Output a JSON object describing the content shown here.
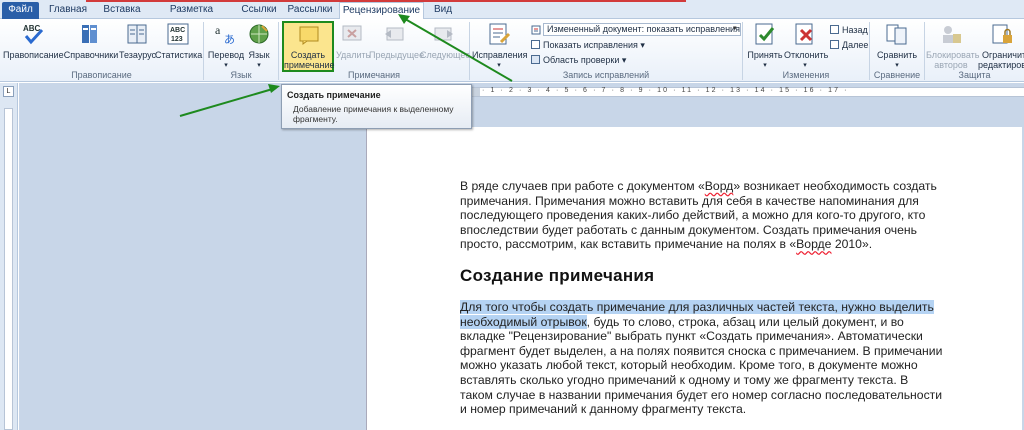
{
  "tabs": [
    {
      "label": "Файл",
      "kind": "file"
    },
    {
      "label": "Главная"
    },
    {
      "label": "Вставка"
    },
    {
      "label": "Разметка страницы"
    },
    {
      "label": "Ссылки"
    },
    {
      "label": "Рассылки"
    },
    {
      "label": "Рецензирование",
      "active": true
    },
    {
      "label": "Вид"
    }
  ],
  "ribbon": {
    "spelling": "Правописание",
    "references": "Справочники",
    "thesaurus": "Тезаурус",
    "statistics": "Статистика",
    "translate": "Перевод",
    "language": "Язык",
    "new_comment_l1": "Создать",
    "new_comment_l2": "примечание",
    "delete": "Удалить",
    "previous": "Предыдущее",
    "next": "Следующее",
    "track_changes": "Исправления",
    "display_for_review": "Измененный документ: показать исправления",
    "show_markup": "Показать исправления",
    "reviewing_pane": "Область проверки",
    "accept": "Принять",
    "reject": "Отклонить",
    "prev_change": "Назад",
    "next_change": "Далее",
    "compare": "Сравнить",
    "block_authors_l1": "Блокировать",
    "block_authors_l2": "авторов",
    "restrict_l1": "Ограничить",
    "restrict_l2": "редактирование",
    "abc_label": "ABC",
    "abc123_label": "ABC\n123",
    "groups": {
      "proofing": "Правописание",
      "language": "Язык",
      "comments": "Примечания",
      "tracking": "Запись исправлений",
      "changes": "Изменения",
      "compare": "Сравнение",
      "protect": "Защита"
    }
  },
  "tooltip": {
    "title": "Создать примечание",
    "description": "Добавление примечания к выделенному фрагменту."
  },
  "ruler": {
    "corner_glyph": "L",
    "marks": "· 1 · 2 · 3 · 4 · 5 · 6 · 7 · 8 · 9 · 10 · 11 · 12 · 13 · 14 · 15 · 16 · 17 ·"
  },
  "document": {
    "para1": {
      "lines": [
        [
          "В ряде случаев при работе с документом «",
          "Ворд",
          "» возникает необходимость создать"
        ],
        [
          "примечания. Примечания можно вставить для себя в качестве напоминания для"
        ],
        [
          "последующего проведения каких-либо действий, а можно для кого-то другого, кто"
        ],
        [
          "впоследствии будет работать с данным документом. Создать примечания очень"
        ],
        [
          "просто, рассмотрим, как вставить примечание на полях в «",
          "Ворде",
          " 2010»."
        ]
      ]
    },
    "heading": "Создание примечания",
    "para2": {
      "hl1": "Для того чтобы создать примечание для различных частей текста, нужно выделить",
      "hl2": "необходимый отрывок",
      "after_hl2": ", будь то слово, строка, абзац или целый документ, и во",
      "lines": [
        "вкладке \"Рецензирование\" выбрать пункт «Создать примечания». Автоматически",
        "фрагмент будет выделен, а на полях появится сноска с примечанием. В примечании",
        "можно указать любой текст, который необходим. Кроме того, в документе можно",
        "вставлять сколько угодно примечаний к одному и тому же фрагменту текста. В",
        "таком случае в названии примечания будет его номер согласно последовательности",
        "и номер примечаний к данному фрагменту текста."
      ]
    }
  },
  "colors": {
    "highlight_frame": "#1e8a1e",
    "arrow": "#1e8a1e",
    "selection": "#b5d3f3"
  }
}
